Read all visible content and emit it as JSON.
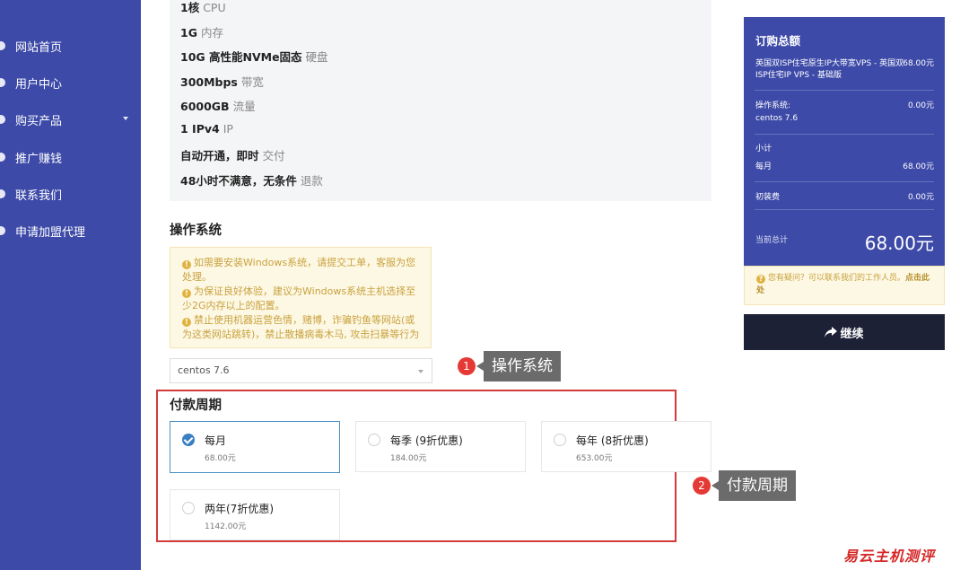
{
  "sidebar": {
    "items": [
      {
        "label": "网站首页"
      },
      {
        "label": "用户中心"
      },
      {
        "label": "购买产品",
        "has_submenu": true
      },
      {
        "label": "推广赚钱"
      },
      {
        "label": "联系我们"
      },
      {
        "label": "申请加盟代理"
      }
    ]
  },
  "specs": [
    {
      "value": "1核",
      "label": "CPU"
    },
    {
      "value": "1G",
      "label": "内存"
    },
    {
      "value": "10G 高性能NVMe固态",
      "label": "硬盘"
    },
    {
      "value": "300Mbps",
      "label": "带宽"
    },
    {
      "value": "6000GB",
      "label": "流量"
    },
    {
      "value": "1 IPv4",
      "label": "IP"
    },
    {
      "value": "自动开通，即时",
      "label": "交付"
    },
    {
      "value": "48小时不满意，无条件",
      "label": "退款"
    }
  ],
  "os_section": {
    "title": "操作系统",
    "notices": [
      "如需要安装Windows系统，请提交工单，客服为您处理。",
      "为保证良好体验，建议为Windows系统主机选择至少2G内存以上的配置。",
      "禁止使用机器运营色情，赌博，诈骗钓鱼等网站(或为这类网站跳转)，禁止散播病毒木马, 攻击扫暴等行为"
    ],
    "selected_os": "centos 7.6"
  },
  "billing_section": {
    "title": "付款周期",
    "options": [
      {
        "name": "每月",
        "price": "68.00元",
        "selected": true
      },
      {
        "name": "每季 (9折优惠)",
        "price": "184.00元",
        "selected": false
      },
      {
        "name": "每年 (8折优惠)",
        "price": "653.00元",
        "selected": false
      },
      {
        "name": "两年(7折优惠)",
        "price": "1142.00元",
        "selected": false
      }
    ]
  },
  "annotations": [
    {
      "number": "1",
      "label": "操作系统"
    },
    {
      "number": "2",
      "label": "付款周期"
    }
  ],
  "summary": {
    "title": "订购总额",
    "product_name": "英国双ISP住宅原生IP大带宽VPS - 英国双ISP住宅IP VPS - 基础版",
    "product_price": "68.00元",
    "os_label": "操作系统:",
    "os_value": "centos 7.6",
    "os_price": "0.00元",
    "subtotal_label": "小计",
    "cycle_label": "每月",
    "cycle_price": "68.00元",
    "setup_label": "初装费",
    "setup_price": "0.00元",
    "total_label": "当前总计",
    "total_value": "68.00元"
  },
  "help": {
    "text": "您有疑问？可以联系我们的工作人员。",
    "link": "点击此处"
  },
  "continue_label": "继续",
  "watermark": "易云主机测评",
  "colors": {
    "sidebar_bg": "#3d4aa8",
    "summary_bg": "#3d4aa8",
    "button_bg": "#1d2135",
    "highlight_border": "#d33b3b",
    "notice_text": "#c9a23f",
    "selected_radio": "#3a7fc1"
  }
}
